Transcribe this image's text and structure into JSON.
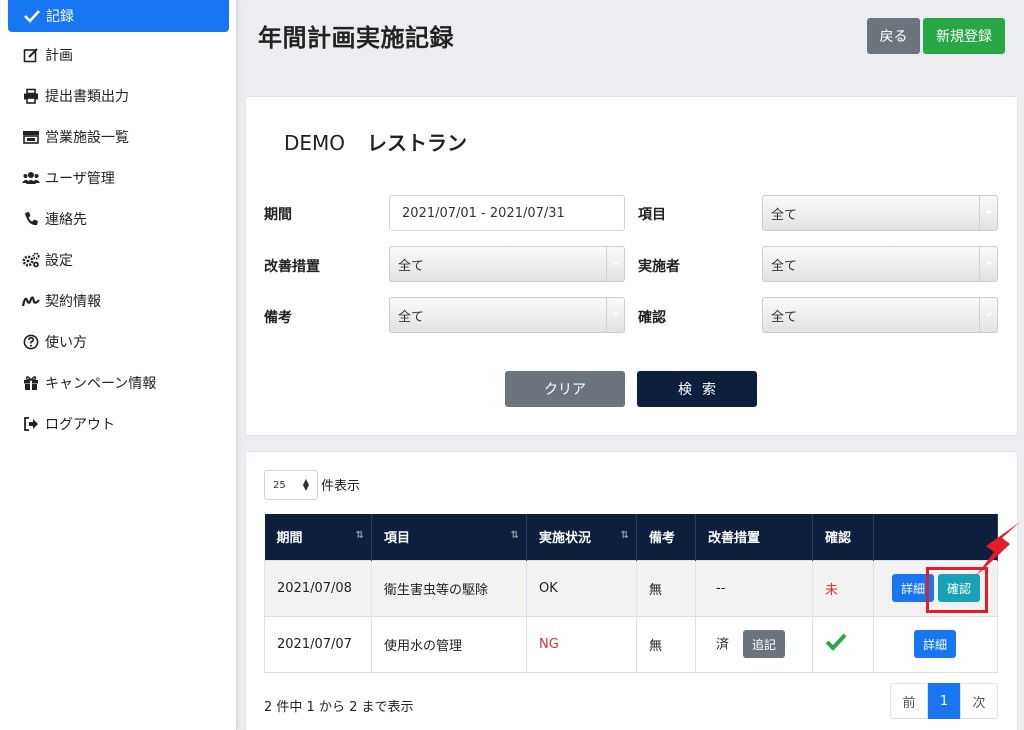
{
  "sidebar": {
    "active": "記録",
    "items": [
      "計画",
      "提出書類出力",
      "営業施設一覧",
      "ユーザ管理",
      "連絡先",
      "設定",
      "契約情報",
      "使い方",
      "キャンペーン情報",
      "ログアウト"
    ]
  },
  "header": {
    "title": "年間計画実施記録",
    "back": "戻る",
    "new": "新規登録"
  },
  "search": {
    "facility_prefix": "DEMO",
    "facility_name": "レストラン",
    "labels": {
      "period": "期間",
      "item": "項目",
      "improvement": "改善措置",
      "implementer": "実施者",
      "remarks": "備考",
      "confirm": "確認"
    },
    "period_value": "2021/07/01 - 2021/07/31",
    "all": "全て",
    "clear": "クリア",
    "search": "検索"
  },
  "results": {
    "length": "25",
    "length_label": "件表示",
    "columns": [
      "期間",
      "項目",
      "実施状況",
      "備考",
      "改善措置",
      "確認",
      ""
    ],
    "rows": [
      {
        "date": "2021/07/08",
        "item": "衛生害虫等の駆除",
        "status": "OK",
        "remarks": "無",
        "improvement": "--",
        "confirm": "未",
        "detail": "詳細",
        "confirm_btn": "確認"
      },
      {
        "date": "2021/07/07",
        "item": "使用水の管理",
        "status": "NG",
        "remarks": "無",
        "improvement": "済",
        "add": "追記",
        "detail": "詳細"
      }
    ],
    "info": "2 件中 1 から 2 まで表示",
    "pager": {
      "prev": "前",
      "current": "1",
      "next": "次"
    }
  },
  "colors": {
    "primary": "#1976f2",
    "navy": "#0d1f3c",
    "success": "#28a745",
    "secondary": "#6c757d",
    "info": "#17a2b8",
    "danger": "#e0312f"
  }
}
